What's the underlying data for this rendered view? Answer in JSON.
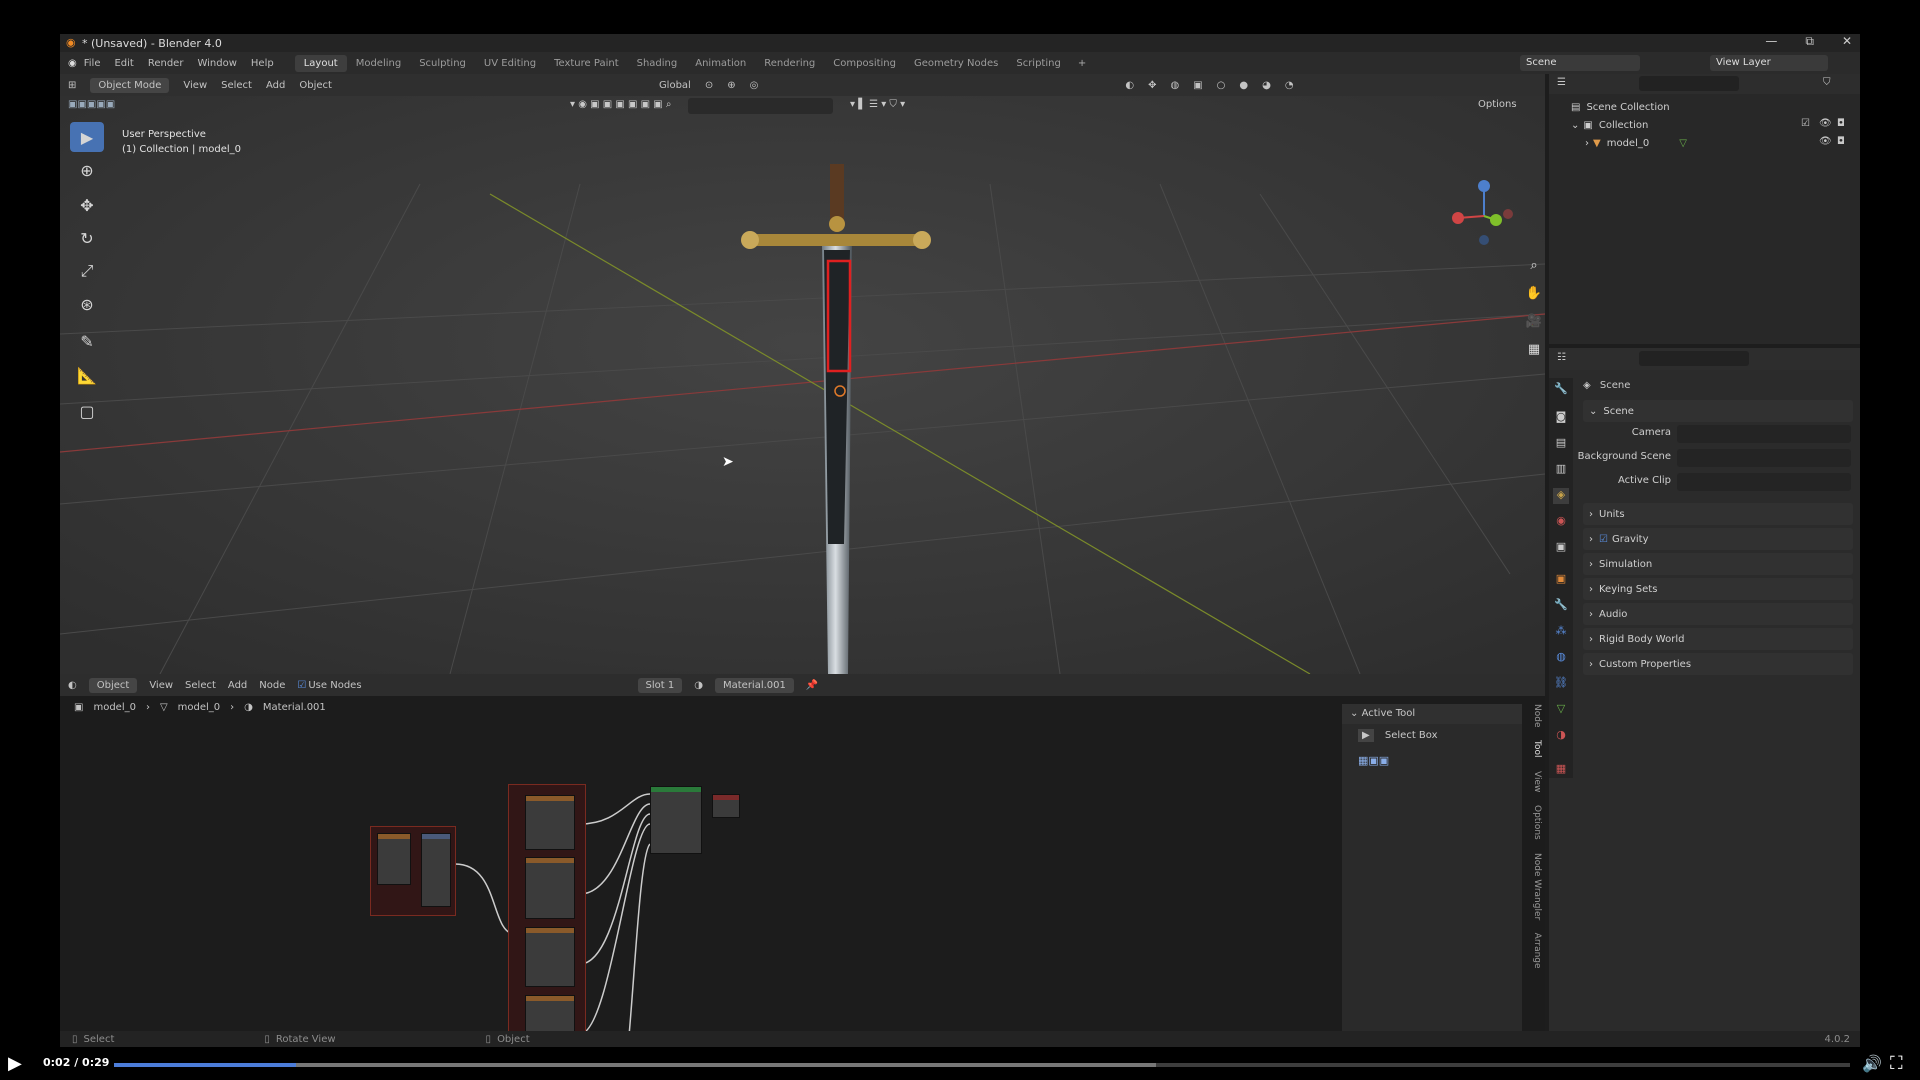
{
  "window": {
    "title": "* (Unsaved) - Blender 4.0"
  },
  "menu": [
    "File",
    "Edit",
    "Render",
    "Window",
    "Help"
  ],
  "workspaces": [
    "Layout",
    "Modeling",
    "Sculpting",
    "UV Editing",
    "Texture Paint",
    "Shading",
    "Animation",
    "Rendering",
    "Compositing",
    "Geometry Nodes",
    "Scripting"
  ],
  "active_workspace": "Layout",
  "scene_name": "Scene",
  "view_layer": "View Layer",
  "viewport": {
    "mode": "Object Mode",
    "menus": [
      "View",
      "Select",
      "Add",
      "Object"
    ],
    "transform": "Global",
    "options": "Options",
    "perspective": "User Perspective",
    "collection_info": "(1) Collection | model_0"
  },
  "node_editor": {
    "type": "Object",
    "menus": [
      "View",
      "Select",
      "Add",
      "Node"
    ],
    "use_nodes": "Use Nodes",
    "slot": "Slot 1",
    "material": "Material.001",
    "breadcrumb": [
      "model_0",
      "model_0",
      "Material.001"
    ],
    "sidebar_panel": "Active Tool",
    "sidebar_tool": "Select Box",
    "tabs": [
      "Node",
      "Tool",
      "View",
      "Options",
      "Node Wrangler",
      "Arrange"
    ]
  },
  "outliner": {
    "root": "Scene Collection",
    "collection": "Collection",
    "object": "model_0"
  },
  "properties": {
    "header": "Scene",
    "section": "Scene",
    "fields": [
      {
        "label": "Camera",
        "value": ""
      },
      {
        "label": "Background Scene",
        "value": ""
      },
      {
        "label": "Active Clip",
        "value": ""
      }
    ],
    "panels": [
      "Units",
      "Gravity",
      "Simulation",
      "Keying Sets",
      "Audio",
      "Rigid Body World",
      "Custom Properties"
    ],
    "gravity_enabled": true
  },
  "statusbar": {
    "select": "Select",
    "rotate": "Rotate View",
    "object": "Object",
    "version": "4.0.2"
  },
  "video": {
    "time": "0:02 / 0:29",
    "progress": 0.105,
    "buffered": 0.6,
    "accent": "#4c7dd9"
  }
}
